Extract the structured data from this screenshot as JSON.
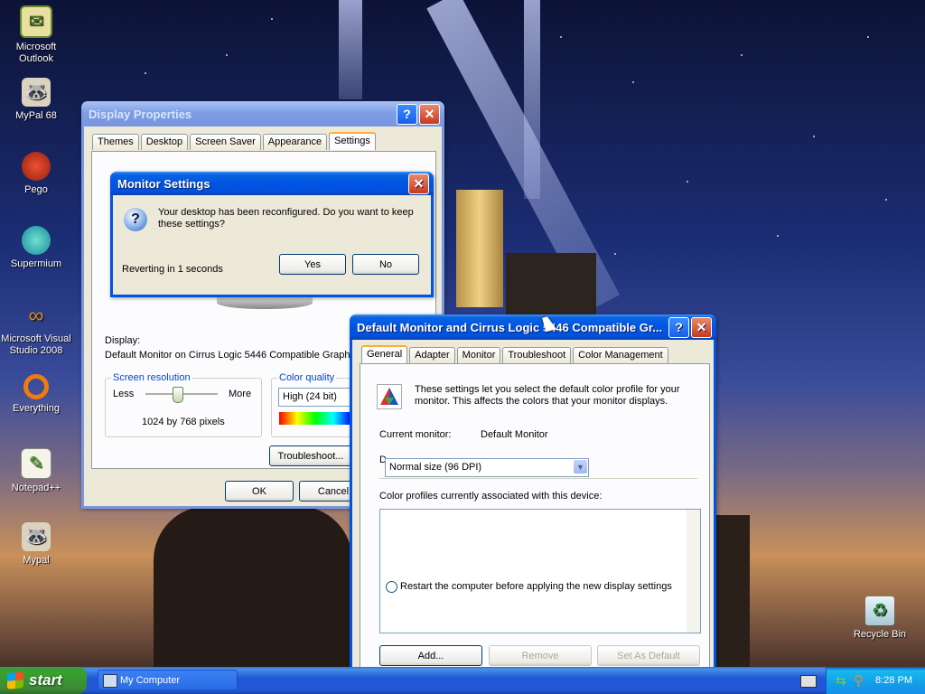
{
  "desktop": {
    "icons": [
      {
        "label": "Microsoft Outlook",
        "icon": "outlook-icon"
      },
      {
        "label": "MyPal 68",
        "icon": "mypal-icon"
      },
      {
        "label": "Pego",
        "icon": "pego-icon"
      },
      {
        "label": "Supermium",
        "icon": "supermium-icon"
      },
      {
        "label": "Microsoft Visual Studio 2008",
        "icon": "visual-studio-icon"
      },
      {
        "label": "Everything",
        "icon": "everything-icon"
      },
      {
        "label": "Notepad++",
        "icon": "notepadpp-icon"
      },
      {
        "label": "Mypal",
        "icon": "mypal-icon"
      },
      {
        "label": "Recycle Bin",
        "icon": "recycle-bin-icon"
      }
    ]
  },
  "display_properties": {
    "title": "Display Properties",
    "tabs": [
      "Themes",
      "Desktop",
      "Screen Saver",
      "Appearance",
      "Settings"
    ],
    "active_tab": "Settings",
    "display_label": "Display:",
    "display_value": "Default Monitor on Cirrus Logic 5446 Compatible Graphics",
    "screen_resolution": {
      "title": "Screen resolution",
      "less": "Less",
      "more": "More",
      "value": "1024 by 768 pixels"
    },
    "color_quality": {
      "title": "Color quality",
      "value": "High (24 bit)"
    },
    "troubleshoot": "Troubleshoot...",
    "ok": "OK",
    "cancel": "Cancel"
  },
  "monitor_settings": {
    "title": "Monitor Settings",
    "message": "Your desktop has been reconfigured.  Do you want to keep these settings?",
    "countdown": "Reverting in 1 seconds",
    "yes": "Yes",
    "no": "No"
  },
  "monitor_props": {
    "title": "Default Monitor and Cirrus Logic 5446 Compatible Gr...",
    "tabs": [
      "General",
      "Adapter",
      "Monitor",
      "Troubleshoot",
      "Color Management"
    ],
    "active_tab": "General",
    "info": "These settings let you select the default color profile for your monitor. This affects the colors that your monitor displays.",
    "current_monitor_label": "Current monitor:",
    "current_monitor_value": "Default Monitor",
    "dpi_label_partial": "D",
    "dpi_value": "Normal size (96 DPI)",
    "profiles_label": "Color profiles currently associated with this device:",
    "restart_option": "Restart the computer before applying the new display settings",
    "add": "Add...",
    "remove": "Remove",
    "set_default": "Set As Default"
  },
  "taskbar": {
    "start": "start",
    "task": "My Computer",
    "clock": "8:28 PM"
  }
}
